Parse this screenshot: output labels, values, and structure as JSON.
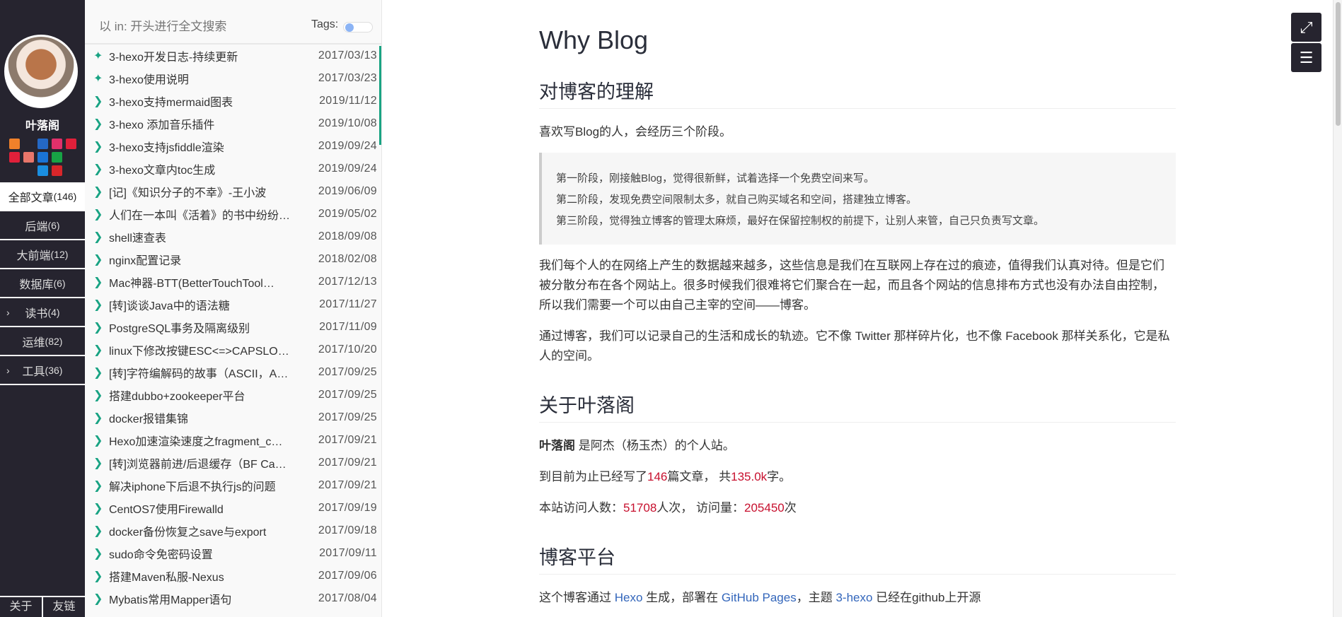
{
  "sidebar": {
    "name": "叶落阁",
    "social_icons": [
      [
        "rss-icon",
        "#f0812a"
      ],
      [
        "github-icon",
        "#26242f"
      ],
      [
        "facebook-icon",
        "#2468c5"
      ],
      [
        "instagram-icon",
        "#e0306a"
      ],
      [
        "weibo-icon",
        "#e0203a"
      ],
      [
        "weibo2-icon",
        "#e0203a"
      ],
      [
        "jianshu-icon",
        "#e8766a"
      ],
      [
        "zhihu-icon",
        "#1a74d6"
      ],
      [
        "csdn-icon",
        "#17a345"
      ],
      [
        "email-icon",
        "#26242f"
      ],
      [
        "qq-icon",
        "#26242f"
      ],
      [
        "kaggle-icon",
        "#1a8ee0"
      ],
      [
        "netease-icon",
        "#d8262a"
      ]
    ],
    "menu": [
      {
        "label": "全部文章",
        "count": "(146)"
      },
      {
        "label": "后端",
        "count": "(6)"
      },
      {
        "label": "大前端",
        "count": "(12)"
      },
      {
        "label": "数据库",
        "count": "(6)"
      },
      {
        "label": "读书",
        "count": "(4)"
      },
      {
        "label": "运维",
        "count": "(82)"
      },
      {
        "label": "工具",
        "count": "(36)"
      }
    ],
    "bottom": [
      "关于",
      "友链"
    ]
  },
  "list": {
    "search_placeholder": "以 in: 开头进行全文搜索",
    "tags_label": "Tags:",
    "posts": [
      [
        "pin",
        "3-hexo开发日志-持续更新",
        "2017/03/13"
      ],
      [
        "pin",
        "3-hexo使用说明",
        "2017/03/23"
      ],
      [
        "arrow",
        "3-hexo支持mermaid图表",
        "2019/11/12"
      ],
      [
        "arrow",
        "3-hexo 添加音乐插件",
        "2019/10/08"
      ],
      [
        "arrow",
        "3-hexo支持jsfiddle渲染",
        "2019/09/24"
      ],
      [
        "arrow",
        "3-hexo文章内toc生成",
        "2019/09/24"
      ],
      [
        "arrow",
        "[记]《知识分子的不幸》-王小波",
        "2019/06/09"
      ],
      [
        "arrow",
        "人们在一本叫《活着》的书中纷纷…",
        "2019/05/02"
      ],
      [
        "arrow",
        "shell速查表",
        "2018/09/08"
      ],
      [
        "arrow",
        "nginx配置记录",
        "2018/02/08"
      ],
      [
        "arrow",
        "Mac神器-BTT(BetterTouchTool…",
        "2017/12/13"
      ],
      [
        "arrow",
        "[转]谈谈Java中的语法糖",
        "2017/11/27"
      ],
      [
        "arrow",
        "PostgreSQL事务及隔离级别",
        "2017/11/09"
      ],
      [
        "arrow",
        "linux下修改按键ESC<=>CAPSLO…",
        "2017/10/20"
      ],
      [
        "arrow",
        "[转]字符编解码的故事（ASCII，A…",
        "2017/09/25"
      ],
      [
        "arrow",
        "搭建dubbo+zookeeper平台",
        "2017/09/25"
      ],
      [
        "arrow",
        "docker报错集锦",
        "2017/09/25"
      ],
      [
        "arrow",
        "Hexo加速渲染速度之fragment_c…",
        "2017/09/21"
      ],
      [
        "arrow",
        "[转]浏览器前进/后退缓存（BF Ca…",
        "2017/09/21"
      ],
      [
        "arrow",
        "解决iphone下后退不执行js的问题",
        "2017/09/21"
      ],
      [
        "arrow",
        "CentOS7使用Firewalld",
        "2017/09/19"
      ],
      [
        "arrow",
        "docker备份恢复之save与export",
        "2017/09/18"
      ],
      [
        "arrow",
        "sudo命令免密码设置",
        "2017/09/11"
      ],
      [
        "arrow",
        "搭建Maven私服-Nexus",
        "2017/09/06"
      ],
      [
        "arrow",
        "Mybatis常用Mapper语句",
        "2017/08/04"
      ]
    ]
  },
  "article": {
    "title": "Why Blog",
    "h_understand": "对博客的理解",
    "p1": "喜欢写Blog的人，会经历三个阶段。",
    "quote": [
      "第一阶段，刚接触Blog，觉得很新鲜，试着选择一个免费空间来写。",
      "第二阶段，发现免费空间限制太多，就自己购买域名和空间，搭建独立博客。",
      "第三阶段，觉得独立博客的管理太麻烦，最好在保留控制权的前提下，让别人来管，自己只负责写文章。"
    ],
    "p2": "我们每个人的在网络上产生的数据越来越多，这些信息是我们在互联网上存在过的痕迹，值得我们认真对待。但是它们被分散分布在各个网站上。很多时候我们很难将它们聚合在一起，而且各个网站的信息排布方式也没有办法自由控制，所以我们需要一个可以由自己主宰的空间——博客。",
    "p3": "通过博客，我们可以记录自己的生活和成长的轨迹。它不像 Twitter 那样碎片化，也不像 Facebook 那样关系化，它是私人的空间。",
    "h_about": "关于叶落阁",
    "about_bold": "叶落阁",
    "about_rest": " 是阿杰（杨玉杰）的个人站。",
    "stats1_a": "到目前为止已经写了",
    "posts_count": "146",
    "stats1_b": "篇文章，  共",
    "words": "135.0k",
    "stats1_c": "字。",
    "stats2_a": "本站访问人数：",
    "visitors": "51708",
    "stats2_b": "人次，  访问量：",
    "views": "205450",
    "stats2_c": "次",
    "h_platform": "博客平台",
    "plat_a": "这个博客通过 ",
    "hexo": "Hexo",
    "plat_b": " 生成，部署在 ",
    "ghpages": "GitHub Pages",
    "plat_c": "，主题 ",
    "theme": "3-hexo",
    "plat_d": " 已经在github上开源"
  },
  "colors": {
    "sidebar": "#26242f",
    "accent": "#19a383",
    "highlight": "#c7102e",
    "link": "#3366bb"
  }
}
